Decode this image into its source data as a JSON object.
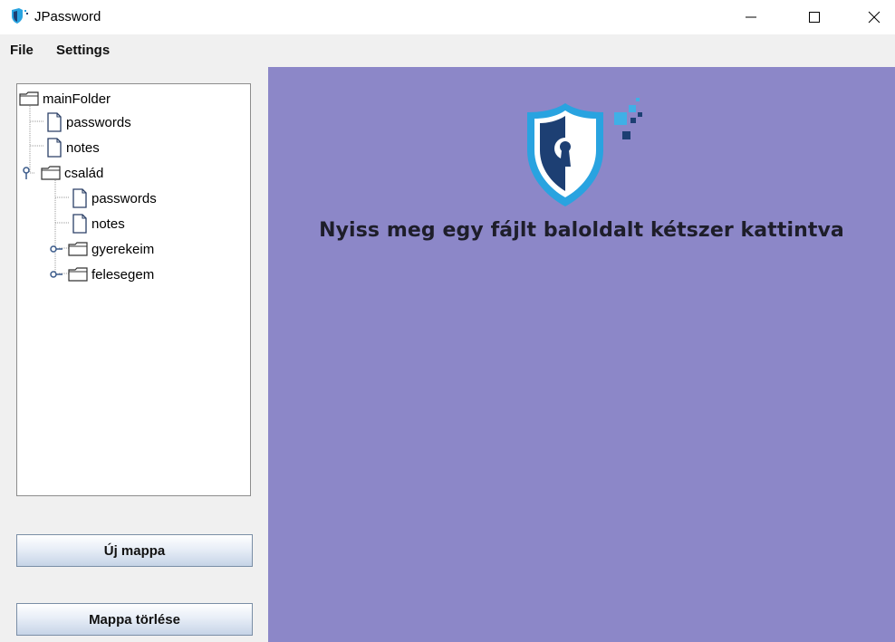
{
  "window": {
    "title": "JPassword"
  },
  "menu": {
    "file": "File",
    "settings": "Settings"
  },
  "tree": {
    "nodes": [
      {
        "label": "mainFolder",
        "type": "folder"
      },
      {
        "label": "passwords",
        "type": "file"
      },
      {
        "label": "notes",
        "type": "file"
      },
      {
        "label": "család",
        "type": "folder",
        "expanded": true
      },
      {
        "label": "passwords",
        "type": "file"
      },
      {
        "label": "notes",
        "type": "file"
      },
      {
        "label": "gyerekeim",
        "type": "folder",
        "expanded": false
      },
      {
        "label": "felesegem",
        "type": "folder",
        "expanded": false
      }
    ]
  },
  "buttons": {
    "new_folder": "Új mappa",
    "delete_folder": "Mappa törlése"
  },
  "main": {
    "message": "Nyiss meg egy fájlt baloldalt kétszer kattintva"
  },
  "colors": {
    "main_bg": "#8c87c8",
    "shield_outer": "#29a3e0",
    "shield_dark": "#1d3f73",
    "panel_bg": "#f0f0f0"
  },
  "icons": [
    "shield-keyhole-icon",
    "folder-icon",
    "file-icon",
    "tree-toggle-icon",
    "minimize-icon",
    "maximize-icon",
    "close-icon"
  ]
}
